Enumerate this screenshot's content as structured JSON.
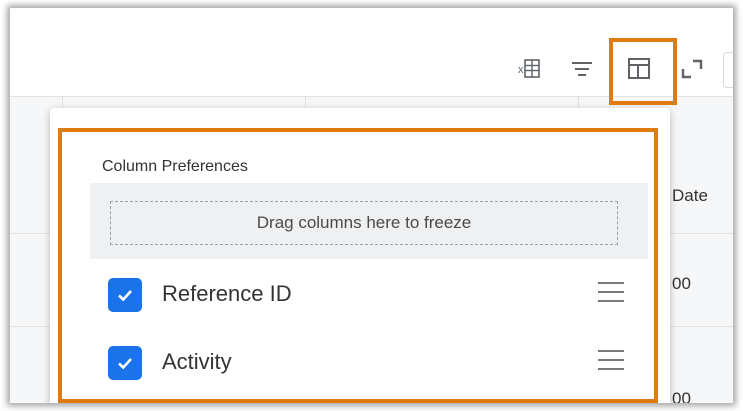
{
  "toolbar": {
    "icons": [
      "excel-export-icon",
      "filter-icon",
      "column-preferences-icon",
      "fullscreen-icon"
    ],
    "highlight_color": "#e07b12"
  },
  "background_grid": {
    "header_partial": "Date",
    "row1_partial": "00",
    "row2_partial": "00"
  },
  "column_preferences": {
    "title": "Column Preferences",
    "freeze_placeholder": "Drag columns here to freeze",
    "items": [
      {
        "label": "Reference ID",
        "checked": true
      },
      {
        "label": "Activity",
        "checked": true
      }
    ],
    "checkbox_color": "#1a73e8"
  }
}
